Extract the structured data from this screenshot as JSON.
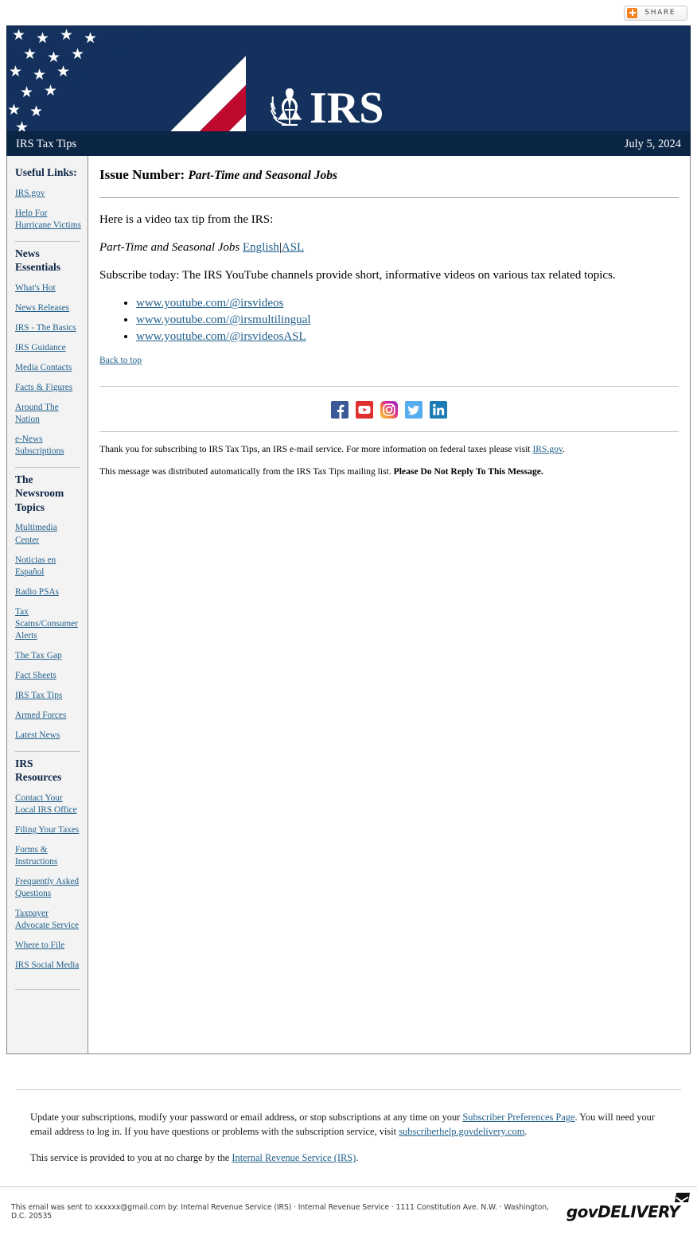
{
  "share": {
    "label": "SHARE",
    "icon": "plus-icon",
    "accent": "#f58220"
  },
  "banner": {
    "logo_text": "IRS",
    "navy": "#13315c",
    "red": "#bf0a30",
    "white": "#ffffff"
  },
  "titlebar": {
    "newsletter": "IRS Tax Tips",
    "date": "July 5, 2024",
    "bg": "#0b2545"
  },
  "sidebar": {
    "sections": [
      {
        "heading": "Useful Links:",
        "links": [
          "IRS.gov",
          "Help For Hurricane Victims"
        ]
      },
      {
        "heading": "News Essentials",
        "links": [
          "What's Hot",
          "News Releases",
          "IRS - The Basics",
          "IRS Guidance",
          "Media Contacts",
          "Facts & Figures",
          "Around The Nation",
          "e-News Subscriptions"
        ]
      },
      {
        "heading": "The Newsroom Topics",
        "links": [
          "Multimedia Center",
          "Noticias en Español",
          "Radio PSAs",
          "Tax Scams/Consumer Alerts",
          "The Tax Gap",
          "Fact Sheets",
          "IRS Tax Tips",
          "Armed Forces",
          "Latest News"
        ]
      },
      {
        "heading": "IRS Resources",
        "links": [
          "Contact Your Local IRS Office",
          "Filing Your Taxes",
          "Forms & Instructions",
          "Frequently Asked Questions",
          "Taxpayer Advocate Service",
          "Where to File",
          "IRS Social Media"
        ]
      }
    ]
  },
  "content": {
    "issue_label": "Issue Number:",
    "issue_subject": "Part-Time and Seasonal Jobs",
    "intro": "Here is a video tax tip from the IRS:",
    "video_title": "Part-Time and Seasonal Jobs",
    "video_lang_english": "English",
    "video_lang_separator": "|",
    "video_lang_asl": "ASL",
    "subscribe": "Subscribe today: The IRS YouTube channels provide short, informative videos on various tax related topics.",
    "youtube_links": [
      "www.youtube.com/@irsvideos",
      "www.youtube.com/@irsmultilingual",
      "www.youtube.com/@irsvideosASL"
    ],
    "back_to_top": "Back to top",
    "social_icons": [
      {
        "name": "facebook-icon",
        "color": "#3b5998"
      },
      {
        "name": "youtube-icon",
        "color": "#e02f2f"
      },
      {
        "name": "instagram-icon",
        "color": "#d6249f"
      },
      {
        "name": "twitter-icon",
        "color": "#55acee"
      },
      {
        "name": "linkedin-icon",
        "color": "#1b7cb5"
      }
    ],
    "thanks_prefix": "Thank you for subscribing to IRS Tax Tips, an IRS e-mail service. For more information on federal taxes please visit ",
    "thanks_link": "IRS.gov",
    "thanks_suffix": ".",
    "auto_prefix": "This message was distributed automatically from the IRS Tax Tips mailing list. ",
    "auto_bold": "Please Do Not Reply To This Message."
  },
  "footer": {
    "update_p1": "Update your subscriptions, modify your password or email address, or stop subscriptions at any time on your ",
    "update_link1": "Subscriber Preferences Page",
    "update_p2": ". You will need your email address to log in. If you have questions or problems with the subscription service, visit ",
    "update_link2": "subscriberhelp.govdelivery.com",
    "update_p3": ".",
    "service_prefix": "This service is provided to you at no charge by the ",
    "service_link": "Internal Revenue Service (IRS)",
    "service_suffix": ".",
    "sent_to": "This email was sent to xxxxxx@gmail.com by: Internal Revenue Service (IRS) · Internal Revenue Service · 1111 Constitution Ave. N.W. · Washington, D.C. 20535",
    "brand": "govDELIVERY"
  }
}
